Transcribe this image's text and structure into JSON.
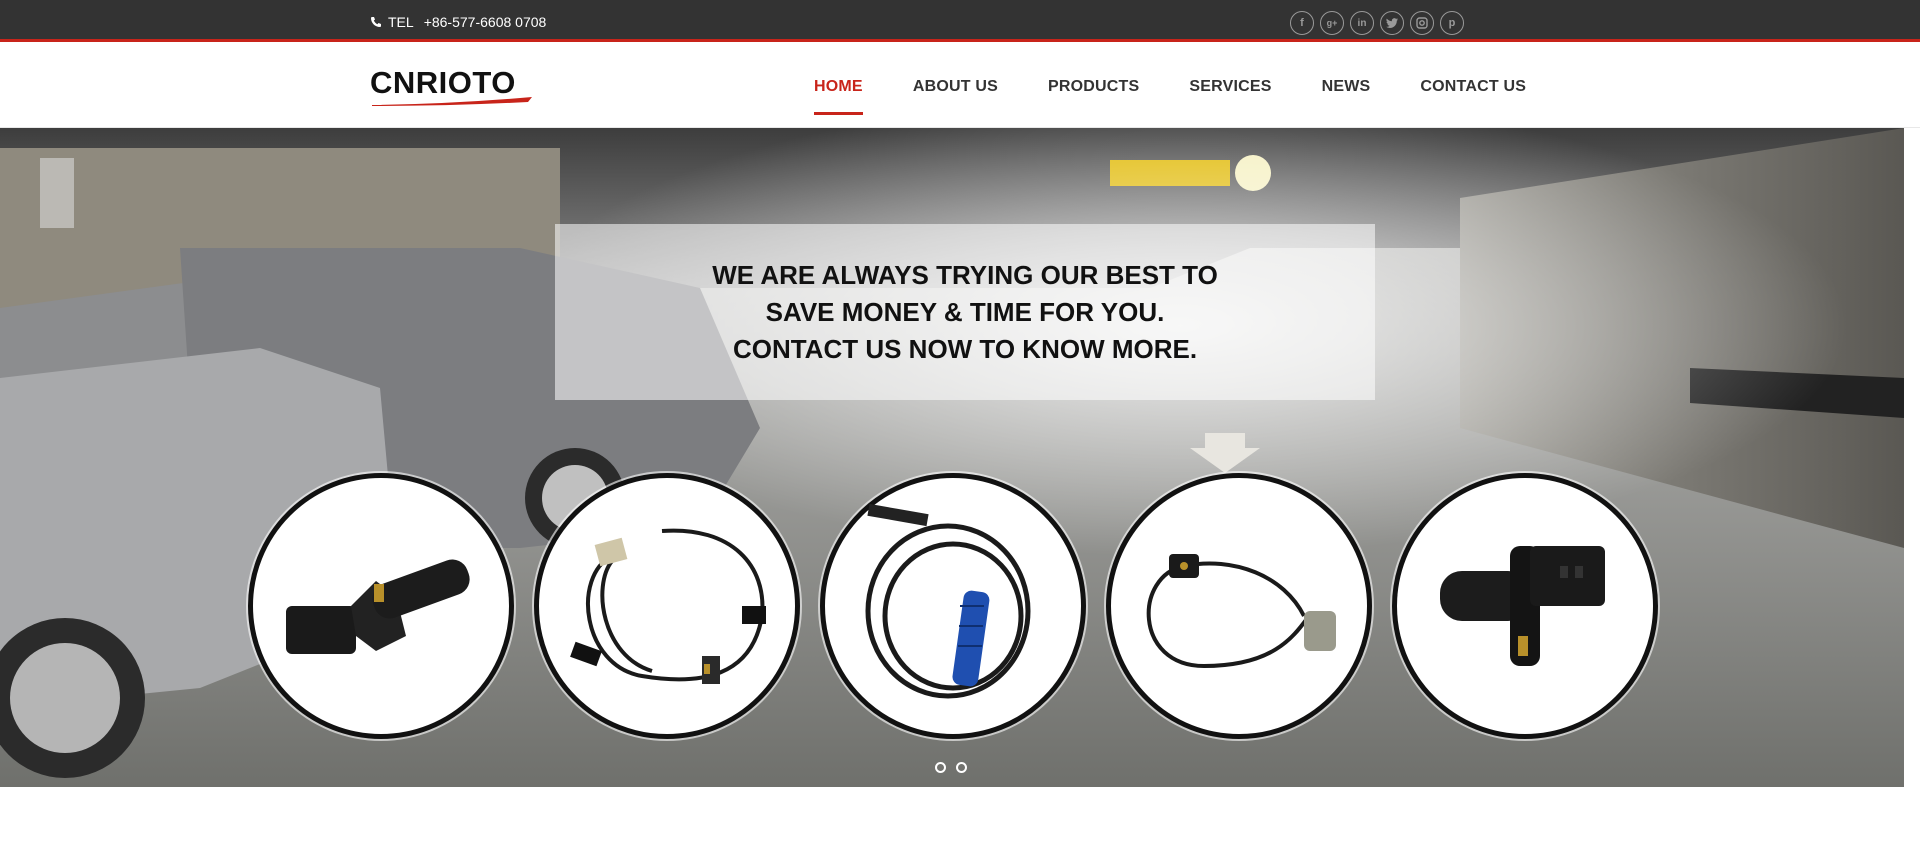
{
  "topbar": {
    "tel_label": "TEL",
    "tel_number": "+86-577-6608 0708",
    "socials": [
      "facebook-icon",
      "google-plus-icon",
      "linkedin-icon",
      "twitter-icon",
      "instagram-icon",
      "pinterest-icon"
    ]
  },
  "header": {
    "logo_text": "CNRIOTO",
    "nav": [
      {
        "label": "HOME",
        "active": true
      },
      {
        "label": "ABOUT US",
        "active": false
      },
      {
        "label": "PRODUCTS",
        "active": false
      },
      {
        "label": "SERVICES",
        "active": false
      },
      {
        "label": "NEWS",
        "active": false
      },
      {
        "label": "CONTACT US",
        "active": false
      }
    ]
  },
  "hero": {
    "lines": [
      "WE ARE ALWAYS TRYING OUR BEST TO",
      "SAVE MONEY & TIME FOR YOU.",
      "CONTACT US NOW TO KNOW MORE."
    ],
    "products": [
      "abs-sensor-icon",
      "wheel-speed-sensor-cable-icon",
      "abs-sensor-blue-icon",
      "speed-sensor-cable-icon",
      "camshaft-sensor-icon"
    ],
    "slide_dots": 2
  },
  "colors": {
    "accent": "#c8241a",
    "topbar": "#333333",
    "text": "#333333"
  }
}
